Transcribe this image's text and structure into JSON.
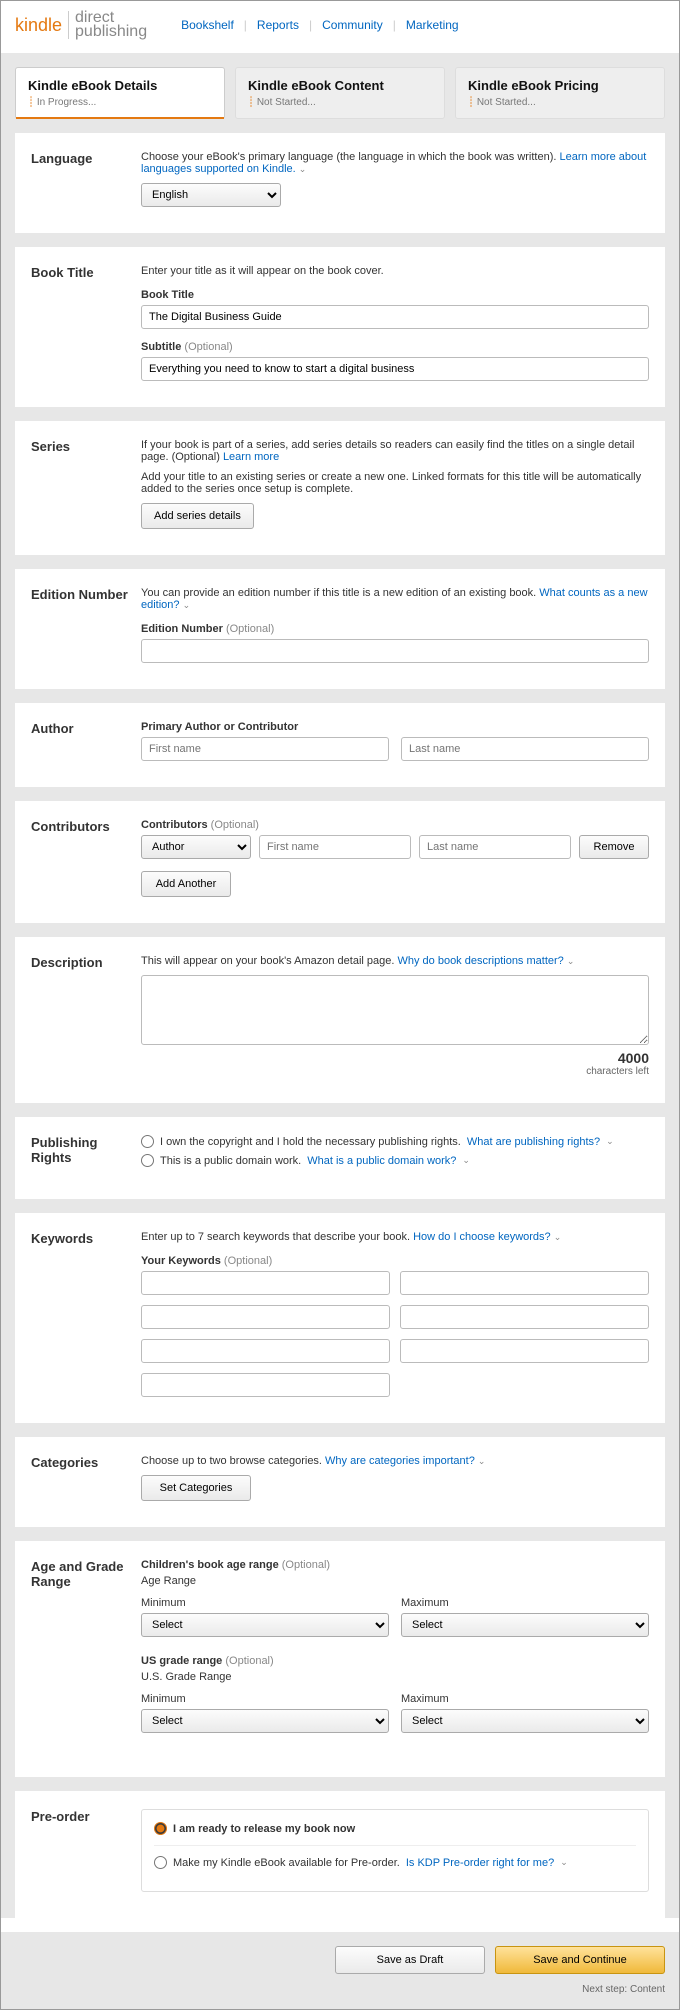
{
  "logo": {
    "kindle": "kindle",
    "dp1": "direct",
    "dp2": "publishing"
  },
  "nav": {
    "bookshelf": "Bookshelf",
    "reports": "Reports",
    "community": "Community",
    "marketing": "Marketing"
  },
  "steps": [
    {
      "title": "Kindle eBook Details",
      "status": "In Progress..."
    },
    {
      "title": "Kindle eBook Content",
      "status": "Not Started..."
    },
    {
      "title": "Kindle eBook Pricing",
      "status": "Not Started..."
    }
  ],
  "language": {
    "label": "Language",
    "helper": "Choose your eBook's primary language (the language in which the book was written). ",
    "link": "Learn more about languages supported on Kindle.",
    "value": "English"
  },
  "title": {
    "label": "Book Title",
    "helper": "Enter your title as it will appear on the book cover.",
    "titleLabel": "Book Title",
    "titleValue": "The Digital Business Guide",
    "subtitleLabel": "Subtitle",
    "subtitleValue": "Everything you need to know to start a digital business"
  },
  "series": {
    "label": "Series",
    "helper1": "If your book is part of a series, add series details so readers can easily find the titles on a single detail page. (Optional) ",
    "link": "Learn more",
    "helper2": "Add your title to an existing series or create a new one. Linked formats for this title will be automatically added to the series once setup is complete.",
    "button": "Add series details"
  },
  "edition": {
    "label": "Edition Number",
    "helper": "You can provide an edition number if this title is a new edition of an existing book. ",
    "link": "What counts as a new edition?",
    "fieldLabel": "Edition Number"
  },
  "author": {
    "label": "Author",
    "fieldLabel": "Primary Author or Contributor",
    "firstPh": "First name",
    "lastPh": "Last name"
  },
  "contributors": {
    "label": "Contributors",
    "fieldLabel": "Contributors",
    "role": "Author",
    "firstPh": "First name",
    "lastPh": "Last name",
    "remove": "Remove",
    "add": "Add Another"
  },
  "description": {
    "label": "Description",
    "helper": "This will appear on your book's Amazon detail page. ",
    "link": "Why do book descriptions matter?",
    "count": "4000",
    "countLabel": "characters left"
  },
  "rights": {
    "label": "Publishing Rights",
    "opt1": "I own the copyright and I hold the necessary publishing rights. ",
    "link1": "What are publishing rights?",
    "opt2": "This is a public domain work. ",
    "link2": "What is a public domain work?"
  },
  "keywords": {
    "label": "Keywords",
    "helper": "Enter up to 7 search keywords that describe your book. ",
    "link": "How do I choose keywords?",
    "fieldLabel": "Your Keywords"
  },
  "categories": {
    "label": "Categories",
    "helper": "Choose up to two browse categories. ",
    "link": "Why are categories important?",
    "button": "Set Categories"
  },
  "ageRange": {
    "label": "Age and Grade Range",
    "childLabel": "Children's book age range",
    "childSub": "Age Range",
    "gradeLabel": "US grade range",
    "gradeSub": "U.S. Grade Range",
    "min": "Minimum",
    "max": "Maximum",
    "select": "Select"
  },
  "preorder": {
    "label": "Pre-order",
    "opt1": "I am ready to release my book now",
    "opt2": "Make my Kindle eBook available for Pre-order. ",
    "link": "Is KDP Pre-order right for me?"
  },
  "footer": {
    "draft": "Save as Draft",
    "continue": "Save and Continue",
    "next": "Next step: Content"
  },
  "optional": " (Optional)"
}
